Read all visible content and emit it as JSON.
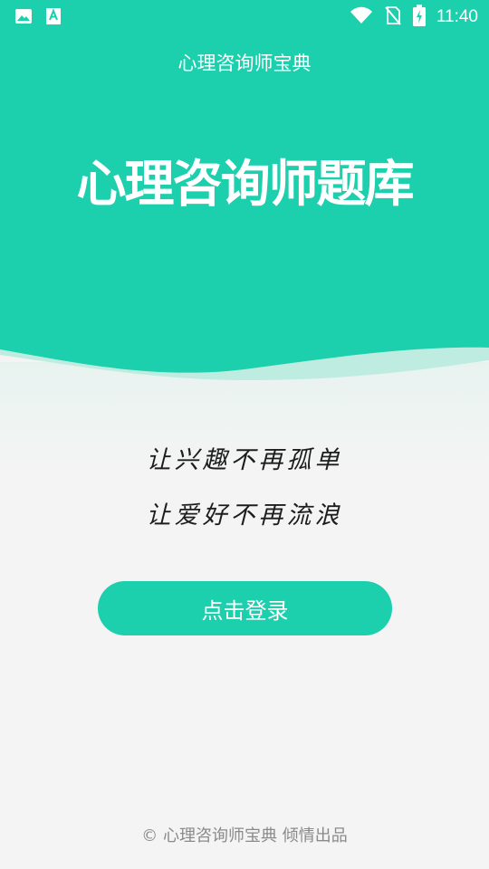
{
  "status_bar": {
    "time": "11:40",
    "icons": [
      "image-icon",
      "text-a-icon",
      "wifi-icon",
      "no-sim-icon",
      "battery-charging-icon"
    ]
  },
  "header": {
    "app_title": "心理咨询师宝典",
    "big_title": "心理咨询师题库"
  },
  "slogans": {
    "line1": "让兴趣不再孤单",
    "line2": "让爱好不再流浪"
  },
  "login": {
    "button_label": "点击登录"
  },
  "footer": {
    "copyright": "© 心理咨询师宝典 倾情出品"
  },
  "colors": {
    "accent": "#1ccfad",
    "wave_light": "#bfece0",
    "background": "#f4f4f4"
  }
}
